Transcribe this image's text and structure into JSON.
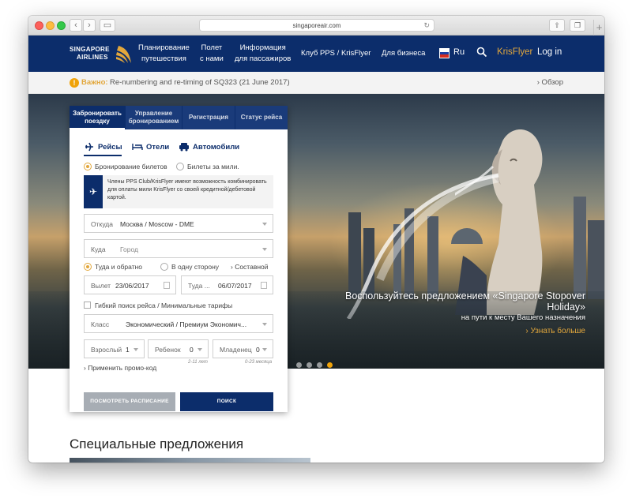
{
  "browser": {
    "url": "singaporeair.com"
  },
  "header": {
    "logo_line1": "SINGAPORE",
    "logo_line2": "AIRLINES",
    "nav": [
      {
        "line1": "Планирование",
        "line2": "путешествия"
      },
      {
        "line1": "Полет",
        "line2": "с нами"
      },
      {
        "line1": "Информация",
        "line2": "для пассажиров"
      },
      {
        "line1": "Клуб PPS / KrisFlyer",
        "line2": ""
      },
      {
        "line1": "Для бизнеса",
        "line2": ""
      }
    ],
    "lang": "Ru",
    "krisflyer": "KrisFlyer",
    "login": "Log in"
  },
  "alert": {
    "label": "Важно:",
    "text": "Re-numbering and re-timing of SQ323 (21 June 2017)",
    "more": "› Обзор"
  },
  "hero": {
    "title_line1": "Воспользуйтесь предложением «Singapore Stopover",
    "title_line2": "Holiday»",
    "subtitle": "на пути к месту Вашего назначения",
    "link": "› Узнать больше",
    "slides": 4,
    "active_slide": 4
  },
  "booking": {
    "tabs": [
      {
        "line1": "Забронировать",
        "line2": "поездку"
      },
      {
        "line1": "Управление",
        "line2": "бронированием"
      },
      {
        "line1": "Регистрация",
        "line2": ""
      },
      {
        "line1": "Статус рейса",
        "line2": ""
      }
    ],
    "modes": [
      "Рейсы",
      "Отели",
      "Автомобили"
    ],
    "booking_type": [
      "Бронирование билетов",
      "Билеты за мили."
    ],
    "info": "Члены PPS Club/KrisFlyer имеют возможность комбинировать для оплаты мили KrisFlyer со своей кредитной/дебетовой картой.",
    "from_label": "Откуда",
    "from_value": "Москва / Moscow - DME",
    "to_label": "Куда",
    "to_placeholder": "Город",
    "trip_types": [
      "Туда и обратно",
      "В одну сторону",
      "› Составной"
    ],
    "depart_label": "Вылет",
    "depart_value": "23/06/2017",
    "return_label": "Туда ...",
    "return_value": "06/07/2017",
    "flexible": "Гибкий поиск рейса / Минимальные тарифы",
    "class_label": "Класс",
    "class_value": "Экономический / Премиум Экономич...",
    "adults_label": "Взрослый",
    "adults_value": "1",
    "children_label": "Ребенок",
    "children_value": "0",
    "children_note": "2-11 лет",
    "infants_label": "Младенец",
    "infants_value": "0",
    "infants_note": "0-23 месяца",
    "promo": "› Применить промо-код",
    "schedule_button": "ПОСМОТРЕТЬ РАСПИСАНИЕ",
    "search_button": "ПОИСК"
  },
  "offers": {
    "title": "Специальные предложения"
  }
}
